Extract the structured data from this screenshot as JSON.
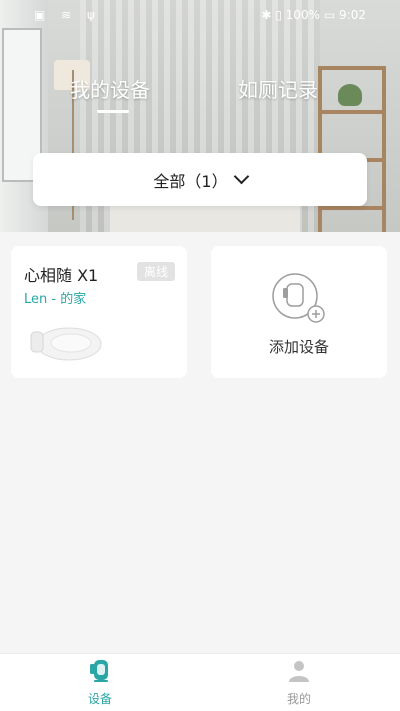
{
  "status_bar": {
    "left": "▣ ≋ ψ",
    "right": "✱ ▯ 100% ▭ 9:02"
  },
  "tabs": [
    {
      "label": "我的设备",
      "active": true
    },
    {
      "label": "如厕记录",
      "active": false
    }
  ],
  "filter": {
    "label": "全部（1）"
  },
  "device_card": {
    "name": "心相随 X1",
    "status": "离线",
    "home": "Len - 的家"
  },
  "add_card": {
    "label": "添加设备"
  },
  "bottom_nav": [
    {
      "label": "设备",
      "active": true
    },
    {
      "label": "我的",
      "active": false
    }
  ],
  "colors": {
    "accent": "#2aa6a6",
    "status_badge": "#e2e2e2"
  }
}
